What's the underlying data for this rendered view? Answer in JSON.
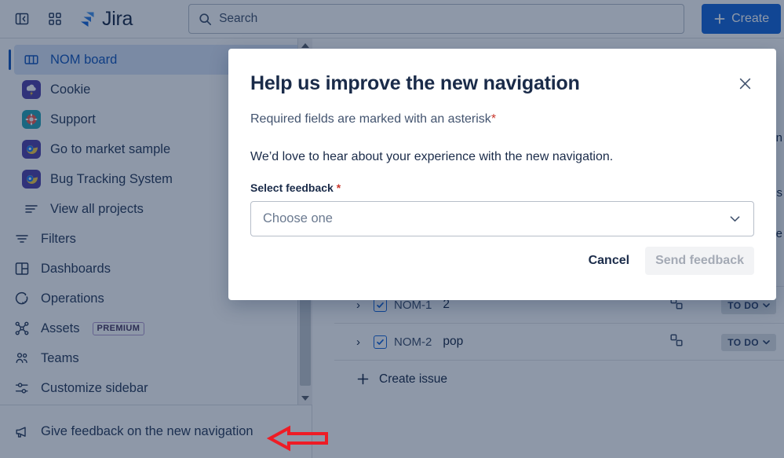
{
  "topnav": {
    "sidebar_toggle_icon": "panel-collapse-icon",
    "app_switcher_icon": "grid-apps-icon",
    "brand": "Jira",
    "search_placeholder": "Search",
    "search_value": "",
    "search_icon": "search-icon",
    "create_label": "Create",
    "create_plus_icon": "plus-icon",
    "create_color": "#1868db"
  },
  "sidebar": {
    "selected_item": "NOM board",
    "accent_color": "#1558bc",
    "selected_bg": "#dbe6f7",
    "items": [
      {
        "label": "NOM board",
        "icon": "board-columns-icon",
        "type": "board",
        "selected": true
      },
      {
        "label": "Cookie",
        "icon": "project-avatar-storm-icon",
        "type": "project",
        "selected": false
      },
      {
        "label": "Support",
        "icon": "project-avatar-lifebuoy-icon",
        "type": "project",
        "selected": false
      },
      {
        "label": "Go to market sample",
        "icon": "project-avatar-bird-icon",
        "type": "project",
        "selected": false
      },
      {
        "label": "Bug Tracking System",
        "icon": "project-avatar-bird-icon",
        "type": "project",
        "selected": false
      },
      {
        "label": "View all projects",
        "icon": "list-lines-icon",
        "type": "link",
        "selected": false
      },
      {
        "label": "Filters",
        "icon": "filter-lines-icon",
        "type": "nav",
        "selected": false
      },
      {
        "label": "Dashboards",
        "icon": "dashboard-grid-icon",
        "type": "nav",
        "selected": false
      },
      {
        "label": "Operations",
        "icon": "operations-radar-icon",
        "type": "nav",
        "selected": false
      },
      {
        "label": "Assets",
        "icon": "assets-nodes-icon",
        "type": "nav",
        "badge": "PREMIUM",
        "selected": false
      },
      {
        "label": "Teams",
        "icon": "teams-people-icon",
        "type": "nav",
        "selected": false
      },
      {
        "label": "Customize sidebar",
        "icon": "sliders-icon",
        "type": "nav",
        "selected": false
      }
    ],
    "footer": {
      "label": "Give feedback on the new navigation",
      "icon": "megaphone-icon"
    },
    "scrollbar": {
      "up_arrow_icon": "triangle-up-icon",
      "down_arrow_icon": "triangle-down-icon"
    }
  },
  "main": {
    "issues": [
      {
        "key": "NOM-1",
        "summary": "2",
        "type_icon": "task-checkbox-icon",
        "subtask_icon": "child-issues-icon",
        "status": "TO DO",
        "status_chevron_icon": "chevron-down-icon",
        "expand_icon": "chevron-right-icon"
      },
      {
        "key": "NOM-2",
        "summary": "pop",
        "type_icon": "task-checkbox-icon",
        "subtask_icon": "child-issues-icon",
        "status": "TO DO",
        "status_chevron_icon": "chevron-down-icon",
        "expand_icon": "chevron-right-icon"
      }
    ],
    "create_issue_label": "Create issue",
    "create_issue_icon": "plus-icon",
    "obscured_fragments": [
      "en",
      "s",
      "be"
    ]
  },
  "modal": {
    "title": "Help us improve the new navigation",
    "close_icon": "close-icon",
    "required_note": "Required fields are marked with an asterisk",
    "required_asterisk": "*",
    "description": "We’d love to hear about your experience with the new navigation.",
    "field_label": "Select feedback",
    "field_required_asterisk": "*",
    "select_placeholder": "Choose one",
    "select_value": "",
    "select_chevron_icon": "chevron-down-icon",
    "cancel_label": "Cancel",
    "submit_label": "Send feedback",
    "submit_disabled": true
  },
  "annotation": {
    "arrow_icon": "left-arrow-annotation",
    "color": "#ee1c25"
  }
}
